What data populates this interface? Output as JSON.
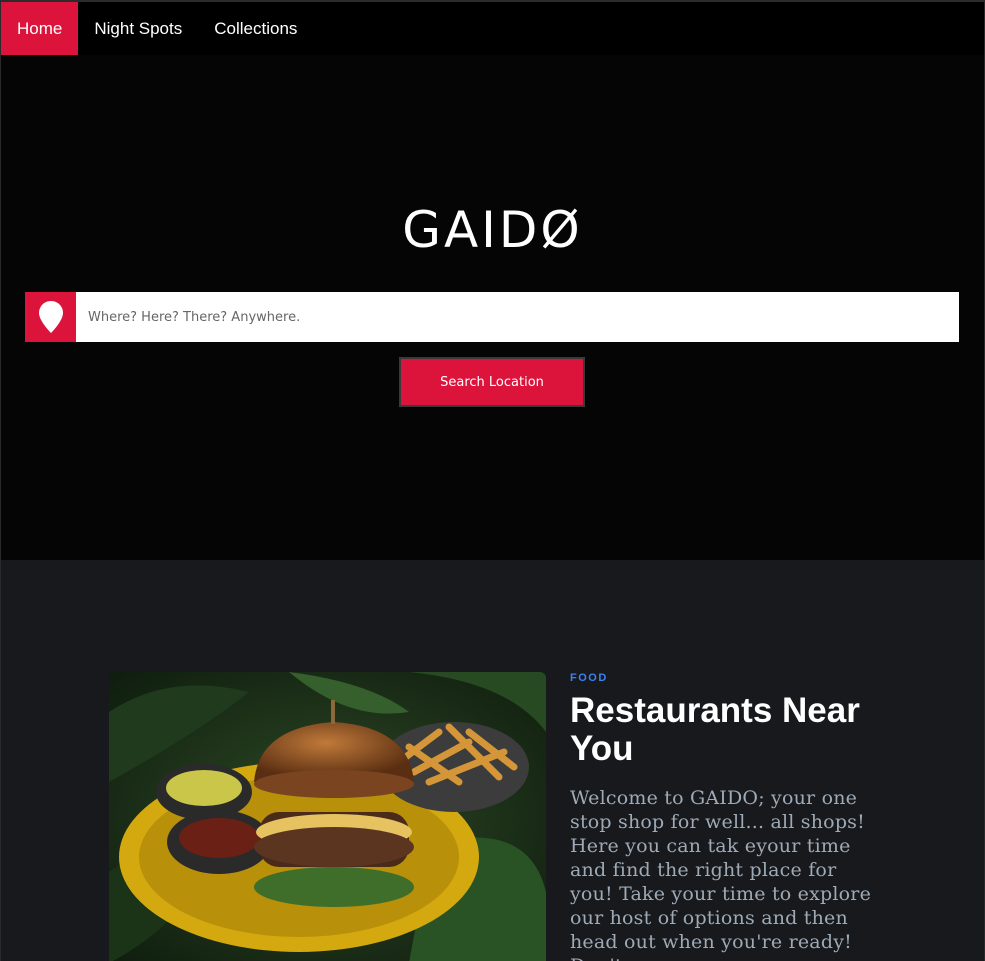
{
  "nav": {
    "items": [
      {
        "label": "Home",
        "active": true
      },
      {
        "label": "Night Spots",
        "active": false
      },
      {
        "label": "Collections",
        "active": false
      }
    ]
  },
  "hero": {
    "logo": "GAIDØ",
    "search": {
      "icon": "map-pin-icon",
      "placeholder": "Where? Here? There? Anywhere.",
      "value": ""
    },
    "search_button_label": "Search Location"
  },
  "feature": {
    "category": "FOOD",
    "title": "Restaurants Near You",
    "body": "Welcome to GAIDO; your one stop shop for well... all shops! Here you can tak eyour time and find the right place for you! Take your time to explore our host of options and then head out when you're ready! Don't",
    "image": "burger-and-fries-photo"
  },
  "colors": {
    "accent": "#dc143c",
    "nav_bg": "#000000",
    "hero_bg": "#050505",
    "section_bg": "#18191d",
    "category": "#3b82f6",
    "body_text": "#9eaab6"
  }
}
